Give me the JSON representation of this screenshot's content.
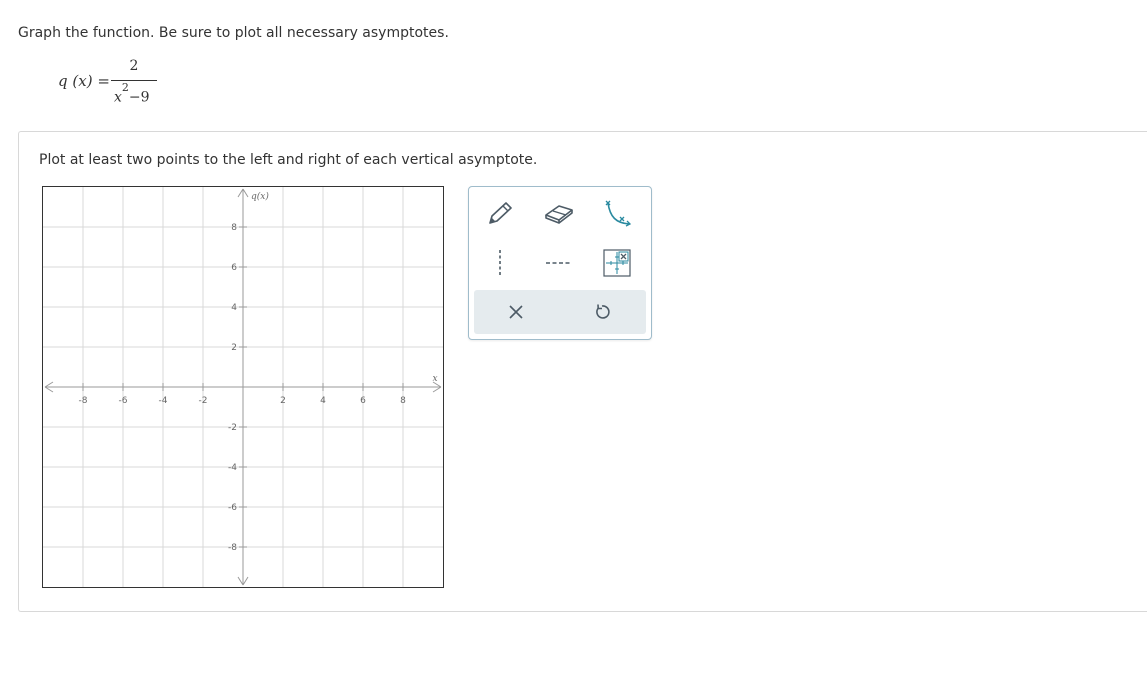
{
  "question": {
    "instruction": "Graph the function. Be sure to plot all necessary asymptotes.",
    "formula": {
      "lhs_name": "q",
      "lhs_arg": "(x)",
      "equals": "=",
      "numerator": "2",
      "denominator_var": "x",
      "denominator_exp": "2",
      "denominator_rest": "−9"
    }
  },
  "panel": {
    "prompt": "Plot at least two points to the left and right of each vertical asymptote."
  },
  "graph": {
    "x_axis_label": "x",
    "y_axis_label": "q(x)",
    "x_range": [
      -10,
      10
    ],
    "y_range": [
      -10,
      10
    ],
    "grid_step": 2,
    "x_tick_labels": [
      "-8",
      "-6",
      "-4",
      "-2",
      "2",
      "4",
      "6",
      "8"
    ],
    "y_tick_labels": [
      "8",
      "6",
      "4",
      "2",
      "-2",
      "-4",
      "-6",
      "-8"
    ],
    "x_tick_values": [
      -8,
      -6,
      -4,
      -2,
      2,
      4,
      6,
      8
    ],
    "y_tick_values": [
      8,
      6,
      4,
      2,
      -2,
      -4,
      -6,
      -8
    ],
    "grid": true
  },
  "toolbox": {
    "tools": [
      {
        "name": "pencil-icon",
        "title": "Point"
      },
      {
        "name": "eraser-icon",
        "title": "Eraser"
      },
      {
        "name": "curve-icon",
        "title": "Curve"
      },
      {
        "name": "vertical-asymptote-icon",
        "title": "Vertical asymptote"
      },
      {
        "name": "horizontal-asymptote-icon",
        "title": "Horizontal asymptote"
      },
      {
        "name": "move-grid-icon",
        "title": "Move"
      }
    ],
    "actions": [
      {
        "name": "clear-icon",
        "title": "Clear"
      },
      {
        "name": "undo-icon",
        "title": "Undo"
      }
    ],
    "accent_color": "#2a8aa0",
    "icon_color": "#4d5b66"
  }
}
